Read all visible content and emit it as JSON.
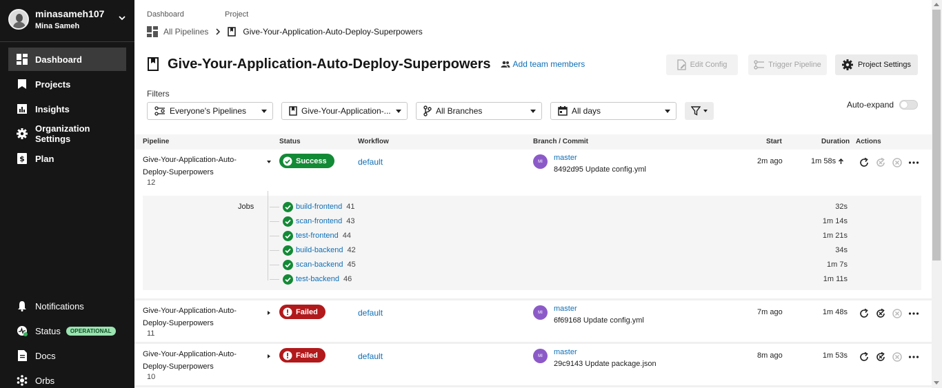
{
  "sidebar": {
    "username": "minasameh107",
    "fullname": "Mina Sameh",
    "nav": [
      {
        "label": "Dashboard",
        "icon": "dashboard-icon"
      },
      {
        "label": "Projects",
        "icon": "bookmark-icon"
      },
      {
        "label": "Insights",
        "icon": "chart-icon"
      },
      {
        "label": "Organization Settings",
        "icon": "gear-icon"
      },
      {
        "label": "Plan",
        "icon": "dollar-icon"
      }
    ],
    "bottom": [
      {
        "label": "Notifications",
        "icon": "bell-icon"
      },
      {
        "label": "Status",
        "icon": "status-icon",
        "badge": "OPERATIONAL"
      },
      {
        "label": "Docs",
        "icon": "doc-icon"
      },
      {
        "label": "Orbs",
        "icon": "orbs-icon"
      }
    ]
  },
  "breadcrumb": {
    "label1": "Dashboard",
    "label2": "Project",
    "item1": "All Pipelines",
    "item2": "Give-Your-Application-Auto-Deploy-Superpowers"
  },
  "header": {
    "title": "Give-Your-Application-Auto-Deploy-Superpowers",
    "add_team": "Add team members",
    "edit_config": "Edit Config",
    "trigger": "Trigger Pipeline",
    "settings": "Project Settings"
  },
  "filters": {
    "label": "Filters",
    "pipelines": "Everyone's Pipelines",
    "project": "Give-Your-Application-...",
    "branches": "All Branches",
    "days": "All days",
    "auto_expand": "Auto-expand"
  },
  "table": {
    "headers": {
      "pipeline": "Pipeline",
      "status": "Status",
      "workflow": "Workflow",
      "branch": "Branch / Commit",
      "start": "Start",
      "duration": "Duration",
      "actions": "Actions"
    },
    "rows": [
      {
        "name_line1": "Give-Your-Application-Auto-",
        "name_line2": "Deploy-Superpowers",
        "number": "12",
        "status": "Success",
        "workflow": "default",
        "avatar": "MI",
        "branch": "master",
        "commit_hash": "8492d95",
        "commit_msg": "Update config.yml",
        "start": "2m ago",
        "duration": "1m 58s"
      },
      {
        "name_line1": "Give-Your-Application-Auto-",
        "name_line2": "Deploy-Superpowers",
        "number": "11",
        "status": "Failed",
        "workflow": "default",
        "avatar": "MI",
        "branch": "master",
        "commit_hash": "6f69168",
        "commit_msg": "Update config.yml",
        "start": "7m ago",
        "duration": "1m 48s"
      },
      {
        "name_line1": "Give-Your-Application-Auto-",
        "name_line2": "Deploy-Superpowers",
        "number": "10",
        "status": "Failed",
        "workflow": "default",
        "avatar": "MI",
        "branch": "master",
        "commit_hash": "29c9143",
        "commit_msg": "Update package.json",
        "start": "8m ago",
        "duration": "1m 53s"
      }
    ],
    "jobs_label": "Jobs",
    "jobs": [
      {
        "name": "build-frontend",
        "num": "41",
        "duration": "32s"
      },
      {
        "name": "scan-frontend",
        "num": "43",
        "duration": "1m 14s"
      },
      {
        "name": "test-frontend",
        "num": "44",
        "duration": "1m 21s"
      },
      {
        "name": "build-backend",
        "num": "42",
        "duration": "34s"
      },
      {
        "name": "scan-backend",
        "num": "45",
        "duration": "1m 7s"
      },
      {
        "name": "test-backend",
        "num": "46",
        "duration": "1m 11s"
      }
    ]
  },
  "colors": {
    "sidebar_bg": "#161616",
    "success": "#138a36",
    "failed": "#b2191b",
    "link": "#0f6fb5",
    "avatar": "#8c5ac8"
  }
}
